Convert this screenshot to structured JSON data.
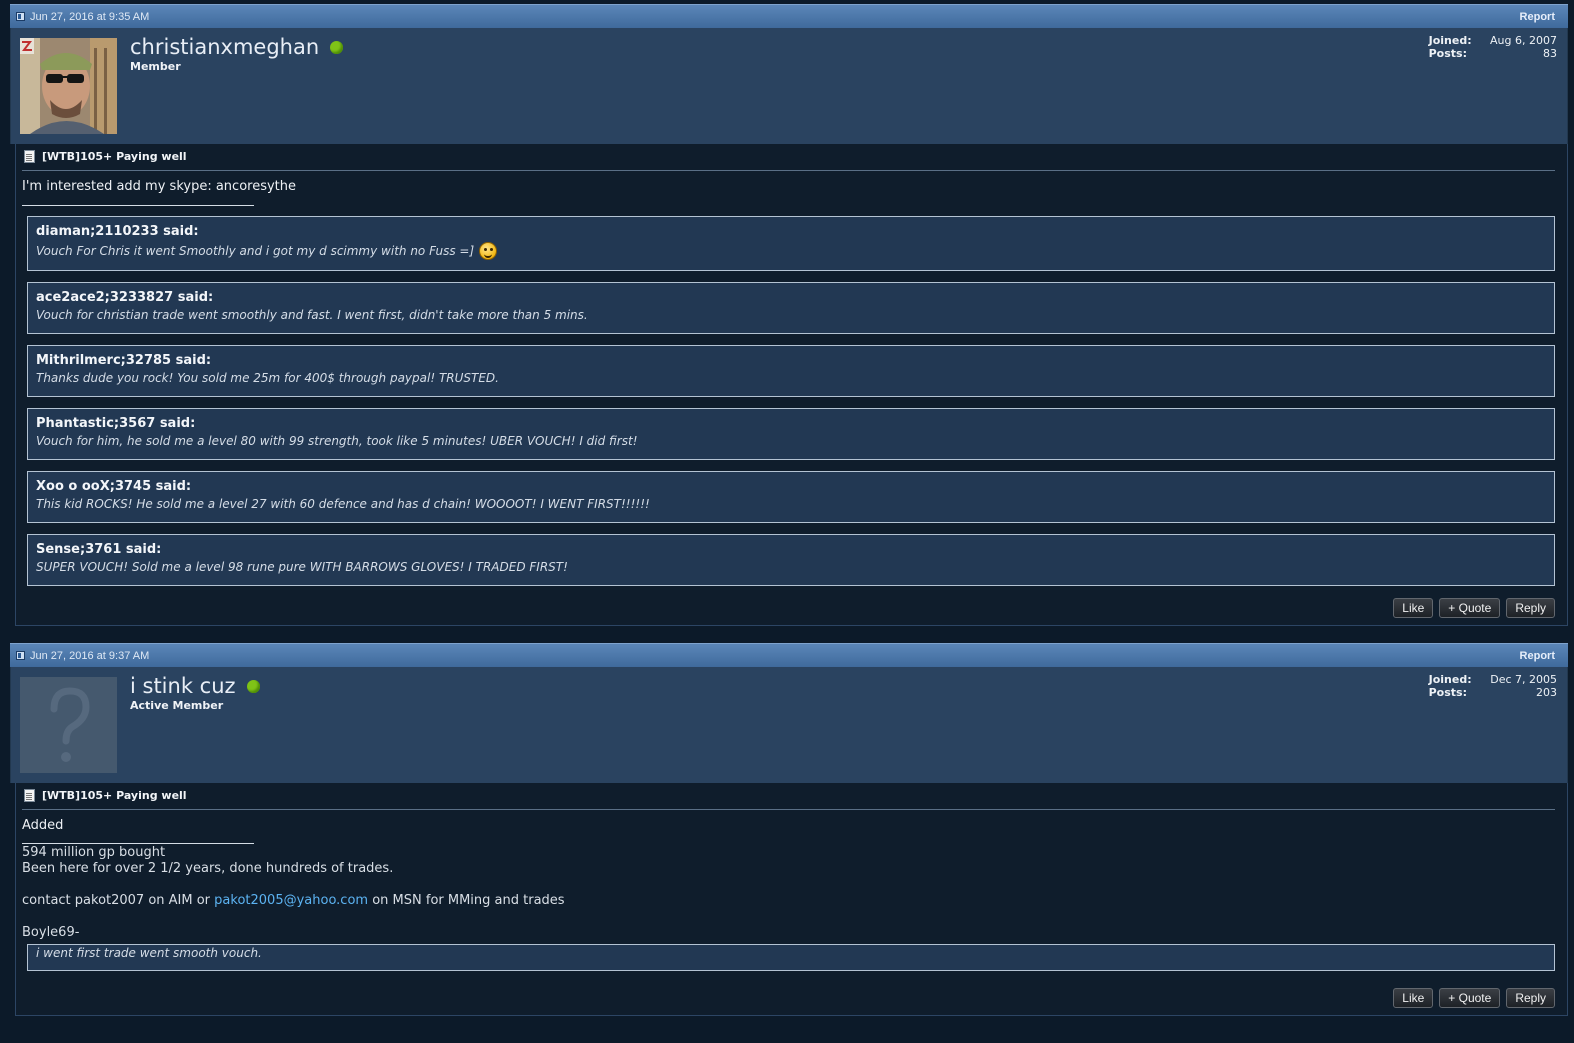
{
  "posts": [
    {
      "date": "Jun 27, 2016 at 9:35 AM",
      "report_label": "Report",
      "username": "christianxmeghan",
      "usertitle": "Member",
      "joined_label": "Joined:",
      "joined_value": "Aug 6, 2007",
      "posts_label": "Posts:",
      "posts_value": "83",
      "title": "[WTB]105+ Paying well",
      "message": "I'm interested add my skype: ancoresythe",
      "quotes": [
        {
          "author": "diaman;2110233 said:",
          "text": "Vouch For Chris it went Smoothly and i got my d scimmy with no Fuss =]"
        },
        {
          "author": "ace2ace2;3233827 said:",
          "text": "Vouch for christian trade went smoothly and fast. I went first, didn't take more than 5 mins."
        },
        {
          "author": "Mithrilmerc;32785 said:",
          "text": "Thanks dude you rock! You sold me 25m for 400$ through paypal! TRUSTED."
        },
        {
          "author": "Phantastic;3567 said:",
          "text": "Vouch for him, he sold me a level 80 with 99 strength, took like 5 minutes! UBER VOUCH! I did first!"
        },
        {
          "author": "Xoo o ooX;3745 said:",
          "text": "This kid ROCKS! He sold me a level 27 with 60 defence and has d chain! WOOOOT! I WENT FIRST!!!!!!"
        },
        {
          "author": "Sense;3761 said:",
          "text": "SUPER VOUCH! Sold me a level 98 rune pure WITH BARROWS GLOVES! I TRADED FIRST!"
        }
      ],
      "buttons": {
        "like": "Like",
        "quote": "+ Quote",
        "reply": "Reply"
      }
    },
    {
      "date": "Jun 27, 2016 at 9:37 AM",
      "report_label": "Report",
      "username": "i stink cuz",
      "usertitle": "Active Member",
      "joined_label": "Joined:",
      "joined_value": "Dec 7, 2005",
      "posts_label": "Posts:",
      "posts_value": "203",
      "title": "[WTB]105+ Paying well",
      "message": "Added",
      "signature": {
        "line1": "594 million gp bought",
        "line2": "Been here for over 2 1/2 years, done hundreds of trades.",
        "contact_prefix": "contact pakot2007 on AIM or ",
        "email": "pakot2005@yahoo.com",
        "contact_suffix": " on MSN for MMing and trades",
        "name": "Boyle69-",
        "quote_text": "i went first trade went smooth vouch."
      },
      "buttons": {
        "like": "Like",
        "quote": "+ Quote",
        "reply": "Reply"
      }
    }
  ]
}
